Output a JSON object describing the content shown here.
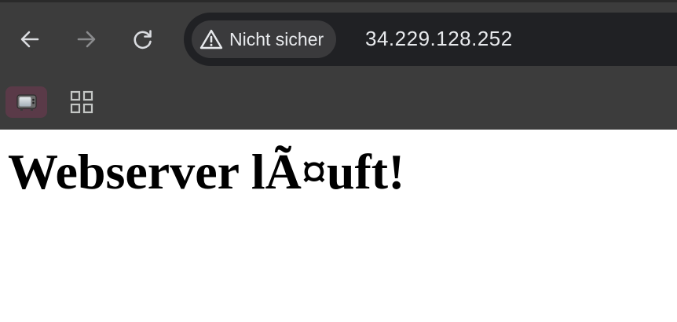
{
  "toolbar": {
    "back_icon": "arrow-left-icon",
    "forward_icon": "arrow-right-icon",
    "reload_icon": "reload-icon"
  },
  "omnibox": {
    "security_icon": "warning-triangle-icon",
    "security_label": "Nicht sicher",
    "url": "34.229.128.252"
  },
  "bookmarks": {
    "app_icon": "tv-icon",
    "apps_icon": "apps-grid-icon"
  },
  "page": {
    "heading": "Webserver lÃ¤uft!"
  },
  "colors": {
    "chrome_bg": "#3c3c3c",
    "omnibox_bg": "#202124",
    "chip_bg": "#3a3a3c",
    "text_light": "#e8eaed",
    "page_bg": "#ffffff"
  }
}
